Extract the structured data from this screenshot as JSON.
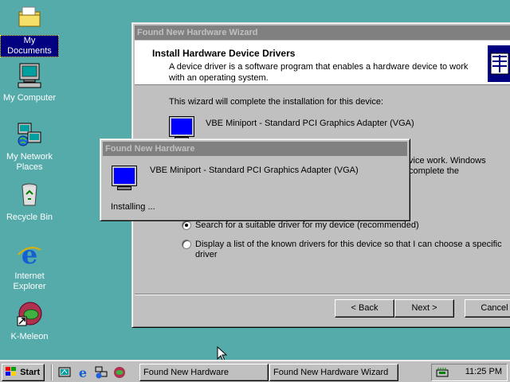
{
  "desktop": {
    "icons": [
      {
        "label": "My Documents",
        "icon": "folder-icon"
      },
      {
        "label": "My Computer",
        "icon": "computer-icon"
      },
      {
        "label": "My Network Places",
        "icon": "network-icon"
      },
      {
        "label": "Recycle Bin",
        "icon": "recycle-bin-icon"
      },
      {
        "label": "Internet Explorer",
        "icon": "ie-icon"
      },
      {
        "label": "K-Meleon",
        "icon": "kmeleon-icon"
      }
    ]
  },
  "wizard": {
    "title": "Found New Hardware Wizard",
    "header_title": "Install Hardware Device Drivers",
    "header_desc": "A device driver is a software program that enables a hardware device to work with an operating system.",
    "intro": "This wizard will complete the installation for this device:",
    "device_name": "VBE Miniport - Standard PCI Graphics Adapter (VGA)",
    "partial_text_line1": "vice work. Windows",
    "partial_text_line2": "complete the",
    "options": [
      {
        "label": "Search for a suitable driver for my device (recommended)",
        "selected": true
      },
      {
        "label": "Display a list of the known drivers for this device so that I can choose a specific driver",
        "selected": false
      }
    ],
    "buttons": {
      "back": "< Back",
      "next": "Next >",
      "cancel": "Cancel"
    }
  },
  "popup": {
    "title": "Found New Hardware",
    "device_name": "VBE Miniport - Standard PCI Graphics Adapter (VGA)",
    "status": "Installing ..."
  },
  "taskbar": {
    "start_label": "Start",
    "tasks": [
      "Found New Hardware",
      "Found New Hardware Wizard"
    ],
    "clock": "11:25 PM"
  },
  "colors": {
    "desktop": "#55aaaa",
    "inactive_title": "#808080",
    "selection": "#000080",
    "monitor_screen": "#0000ff"
  }
}
